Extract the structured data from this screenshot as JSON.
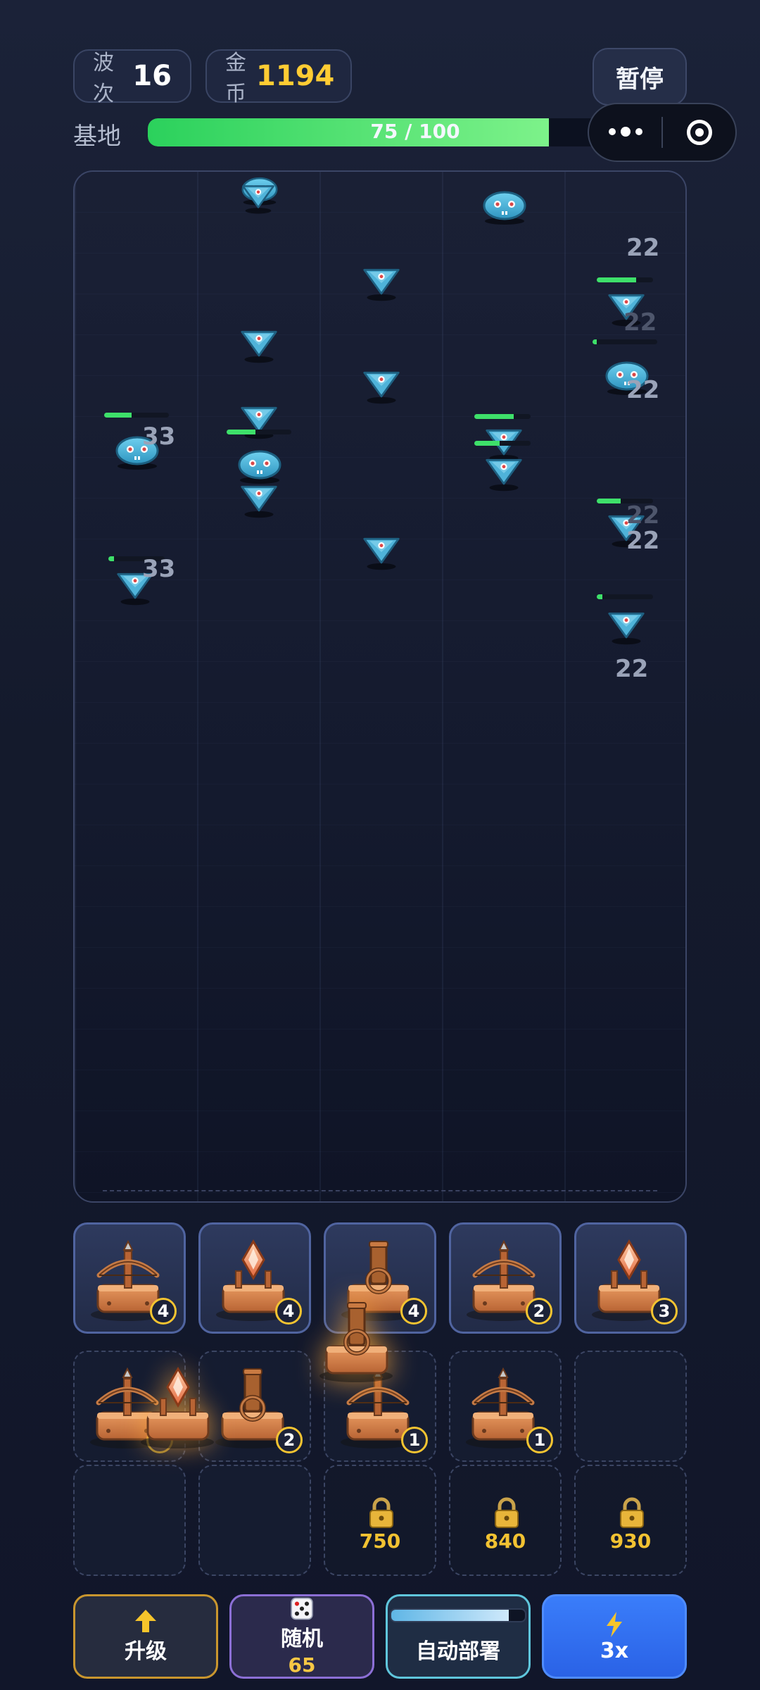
{
  "header": {
    "wave_label": "波次",
    "wave_value": "16",
    "gold_label": "金币",
    "gold_value": "1194",
    "pause_label": "暂停",
    "base_label": "基地",
    "base_hp_text": "75 / 100",
    "base_hp_fraction": 0.75
  },
  "battlefield": {
    "damage_numbers": [
      "22",
      "22",
      "22",
      "33",
      "22",
      "22",
      "33",
      "22"
    ],
    "faint_damage_numbers": [
      "22",
      "22"
    ],
    "enemy_kinds": [
      "arrow-drone",
      "blob-slime"
    ]
  },
  "units": {
    "row1": [
      {
        "type": "crossbow-tower",
        "level": "4"
      },
      {
        "type": "crystal-tower",
        "level": "4"
      },
      {
        "type": "cannon-tower",
        "level": "4"
      },
      {
        "type": "crossbow-tower",
        "level": "2"
      },
      {
        "type": "crystal-tower",
        "level": "3"
      }
    ],
    "row2": [
      {
        "type": "crossbow-tower",
        "level": ""
      },
      {
        "type": "cannon-tower",
        "level": "2"
      },
      {
        "type": "crossbow-tower",
        "level": "1"
      },
      {
        "type": "crossbow-tower",
        "level": "1"
      },
      {
        "type": "empty",
        "level": ""
      }
    ],
    "row3_locks": [
      "750",
      "840",
      "930"
    ]
  },
  "actions": {
    "upgrade_label": "升级",
    "random_label": "随机",
    "random_cost": "65",
    "auto_label": "自动部署",
    "auto_progress": 0.88,
    "speed_label": "3x"
  },
  "colors": {
    "gold": "#ffcc33",
    "hp_green": "#3ee06a",
    "speed_blue": "#3a7dfa",
    "upgrade_border": "#c9962e",
    "random_border": "#8c6fd6",
    "auto_border": "#5fc6dc"
  },
  "icons": [
    "up-arrow-icon",
    "dice-icon",
    "lightning-icon",
    "lock-icon",
    "more-dots-icon",
    "target-icon"
  ]
}
